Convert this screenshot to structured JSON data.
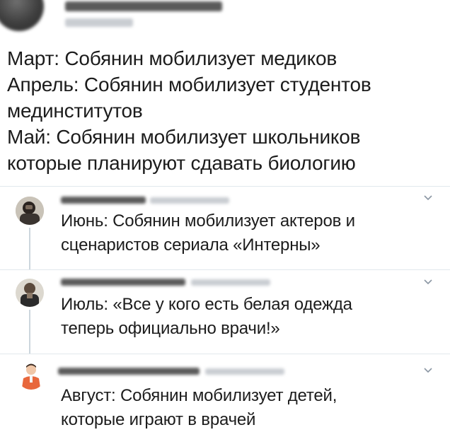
{
  "main_tweet": {
    "lines": [
      "Март: Собянин мобилизует медиков",
      "Апрель: Собянин мобилизует студентов",
      "мединститутов",
      "Май: Собянин мобилизует школьников",
      "которые планируют сдавать биологию"
    ]
  },
  "replies": [
    {
      "lines": [
        "Июнь: Собянин мобилизует актеров и",
        "сценаристов сериала «Интерны»"
      ]
    },
    {
      "lines": [
        "Июль: «Все у кого есть белая одежда",
        "теперь официально врачи!»"
      ]
    },
    {
      "lines": [
        "Август: Собянин мобилизует детей,",
        "которые играют в врачей"
      ]
    }
  ],
  "icons": {
    "chevron": "chevron-down-icon"
  },
  "colors": {
    "text": "#1c1c1c",
    "thread_line": "#ccd6dd",
    "divider": "#e1e8ed"
  }
}
